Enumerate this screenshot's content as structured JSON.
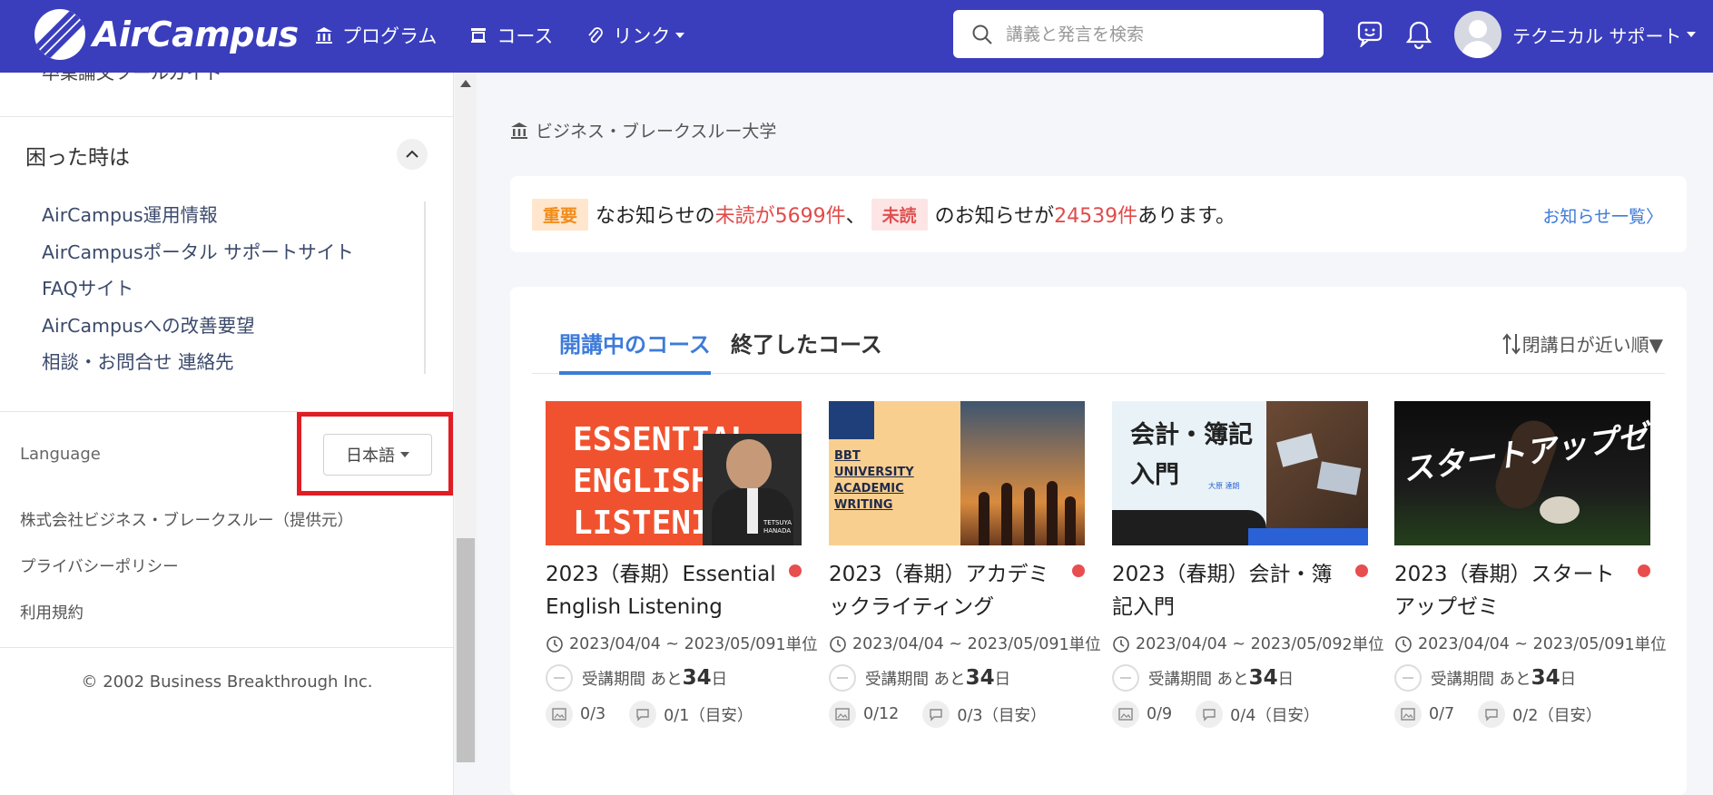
{
  "header": {
    "brand": "AirCampus",
    "nav": [
      {
        "label": "プログラム",
        "icon": "institution-icon"
      },
      {
        "label": "コース",
        "icon": "course-icon"
      },
      {
        "label": "リンク",
        "icon": "paperclip-icon"
      }
    ],
    "search_placeholder": "講義と発言を検索",
    "user_name": "テクニカル サポート"
  },
  "sidebar": {
    "cut_off_item": "卒業論文ツールガイド",
    "help_title": "困った時は",
    "help_items": [
      "AirCampus運用情報",
      "AirCampusポータル サポートサイト",
      "FAQサイト",
      "AirCampusへの改善要望",
      "相談・お問合せ 連絡先"
    ],
    "language_label": "Language",
    "language_value": "日本語",
    "footer_links": [
      "株式会社ビジネス・ブレークスルー（提供元）",
      "プライバシーポリシー",
      "利用規約"
    ],
    "copyright": "© 2002 Business Breakthrough Inc."
  },
  "main": {
    "breadcrumb": "ビジネス・ブレークスルー大学",
    "notice": {
      "important_badge": "重要",
      "text1": "なお知らせの",
      "unread_important": "未読が5699件",
      "sep": "、",
      "unread_badge": "未読",
      "text2": "のお知らせが",
      "unread_total": "24539件",
      "text3": "あります。",
      "link": "お知らせ一覧〉"
    },
    "tabs": [
      "開講中のコース",
      "終了したコース"
    ],
    "sort_label": "閉講日が近い順▼",
    "courses": [
      {
        "title": "2023（春期）Essential English Listening",
        "dates": "2023/04/04 ~ 2023/05/09",
        "units": "1単位",
        "period_label": "受講期間 あと",
        "period_num": "34",
        "period_unit": "日",
        "reports": "0/3",
        "comments": "0/1（目安）",
        "thumb_text": "ESSENTIAL ENGLISH LISTENING",
        "thumb_name": "TETSUYA HANADA"
      },
      {
        "title": "2023（春期）アカデミックライティング",
        "dates": "2023/04/04 ~ 2023/05/09",
        "units": "1単位",
        "period_label": "受講期間 あと",
        "period_num": "34",
        "period_unit": "日",
        "reports": "0/12",
        "comments": "0/3（目安）",
        "thumb_text": "BBT UNIVERSITY ACADEMIC WRITING"
      },
      {
        "title": "2023（春期）会計・簿記入門",
        "dates": "2023/04/04 ~ 2023/05/09",
        "units": "2単位",
        "period_label": "受講期間 あと",
        "period_num": "34",
        "period_unit": "日",
        "reports": "0/9",
        "comments": "0/4（目安）",
        "thumb_text": "会計・簿記入門",
        "thumb_name": "大原 達朗"
      },
      {
        "title": "2023（春期）スタートアップゼミ",
        "dates": "2023/04/04 ~ 2023/05/09",
        "units": "1単位",
        "period_label": "受講期間 あと",
        "period_num": "34",
        "period_unit": "日",
        "reports": "0/7",
        "comments": "0/2（目安）",
        "thumb_text": "スタートアップゼミ"
      }
    ]
  },
  "colors": {
    "header_bg": "#3a3ebd",
    "accent_blue": "#3d7bd9",
    "unread_red": "#e14b4b",
    "important_orange": "#f08c1a",
    "highlight_red": "#e01d24"
  }
}
